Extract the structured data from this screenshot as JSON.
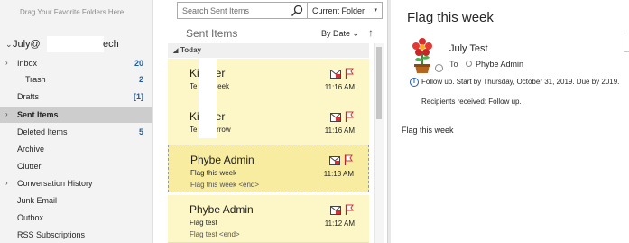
{
  "folder_pane": {
    "favorites_hint": "Drag Your Favorite Folders Here",
    "account": {
      "prefix": "July@",
      "suffix": "ech"
    },
    "folders": [
      {
        "label": "Inbox",
        "count": "20",
        "caret": "›"
      },
      {
        "label": "Trash",
        "count": "2",
        "sub": true
      },
      {
        "label": "Drafts",
        "count": "[1]"
      },
      {
        "label": "Sent Items",
        "caret": "›",
        "selected": true
      },
      {
        "label": "Deleted Items",
        "count": "5"
      },
      {
        "label": "Archive"
      },
      {
        "label": "Clutter"
      },
      {
        "label": "Conversation History",
        "caret": "›"
      },
      {
        "label": "Junk Email"
      },
      {
        "label": "Outbox"
      },
      {
        "label": "RSS Subscriptions"
      }
    ]
  },
  "list_pane": {
    "search_placeholder": "Search Sent Items",
    "scope": "Current Folder",
    "title": "Sent Items",
    "sort_label": "By Date ⌄",
    "sort_arrow": "↑",
    "group_label": "Today",
    "messages": [
      {
        "sender": "Ki   User",
        "subject": "Te   this week",
        "preview": "",
        "time": "11:16 AM"
      },
      {
        "sender": "Ki   User",
        "subject": "Te   Tomorrow",
        "preview": "",
        "time": "11:16 AM"
      },
      {
        "sender": "Phybe Admin",
        "subject": "Flag this week",
        "preview": "Flag this week <end>",
        "time": "11:13 AM"
      },
      {
        "sender": "Phybe Admin",
        "subject": "Flag test",
        "preview": "Flag test <end>",
        "time": "11:12 AM"
      }
    ]
  },
  "reading_pane": {
    "subject": "Flag this week",
    "from": "July Test",
    "to_label": "To",
    "to": "Phybe Admin",
    "info_line1": "Follow up.  Start by Thursday, October 31, 2019.  Due by 2019.",
    "info_line2": "Recipients received: Follow up.",
    "body": "Flag this week"
  },
  "colors": {
    "accent": "#1e5ea8",
    "flag": "#d13438",
    "message_bg": "#fdf6c7",
    "selected_message_bg": "#f8eca0"
  }
}
